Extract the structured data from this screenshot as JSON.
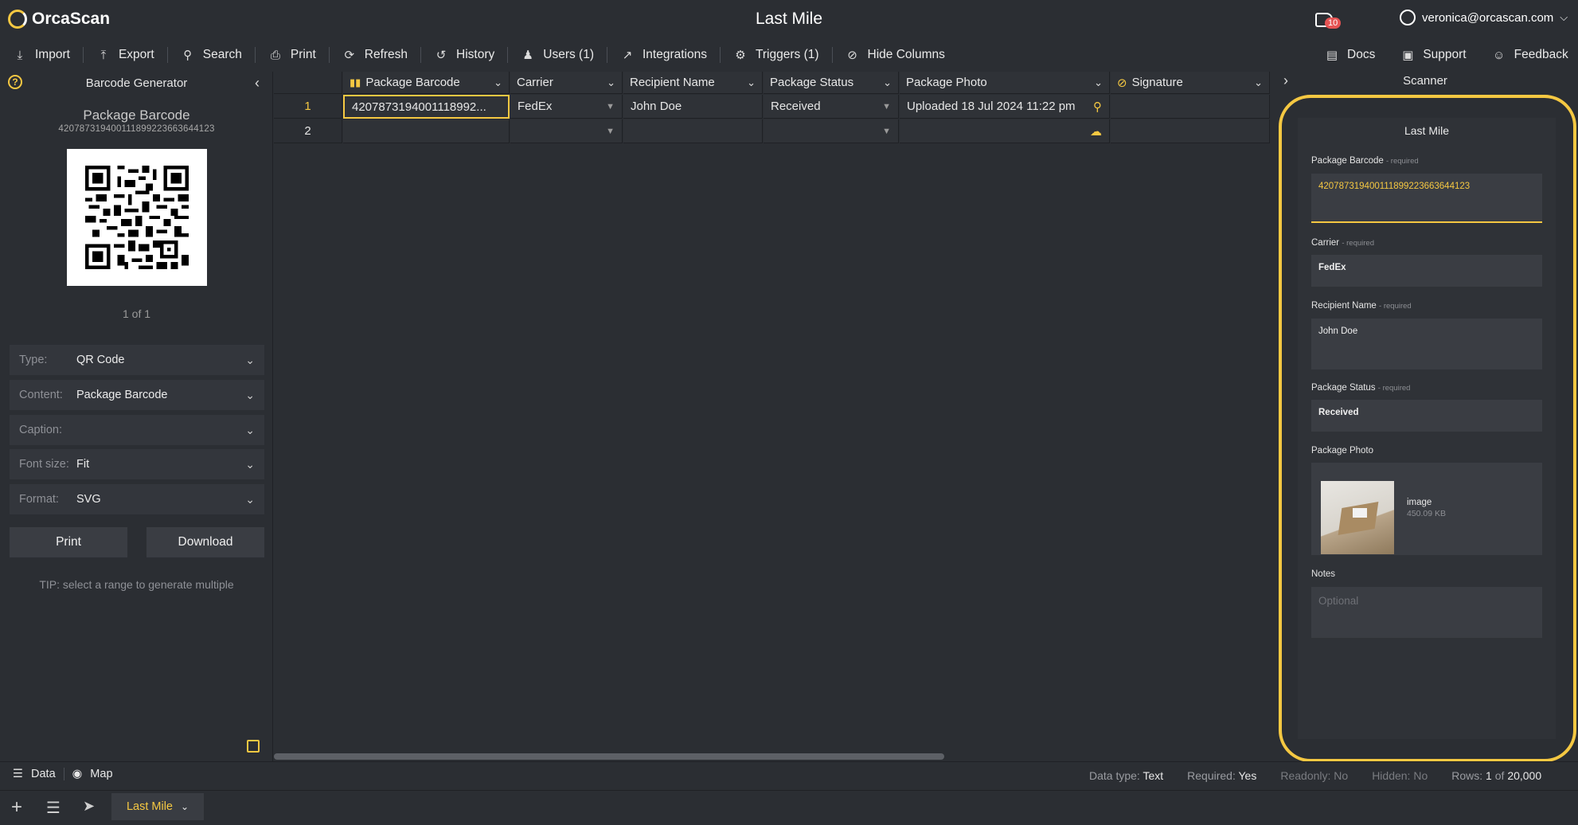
{
  "app": {
    "logo_text": "OrcaScan",
    "title": "Last Mile",
    "notification_count": "10",
    "user_email": "veronica@orcascan.com"
  },
  "toolbar": {
    "left": [
      {
        "label": "Import",
        "icon": "import-icon"
      },
      {
        "label": "Export",
        "icon": "export-icon"
      },
      {
        "label": "Search",
        "icon": "search-icon"
      },
      {
        "label": "Print",
        "icon": "print-icon"
      },
      {
        "label": "Refresh",
        "icon": "refresh-icon"
      },
      {
        "label": "History",
        "icon": "history-icon"
      },
      {
        "label": "Users (1)",
        "icon": "users-icon"
      },
      {
        "label": "Integrations",
        "icon": "integrations-icon"
      },
      {
        "label": "Triggers (1)",
        "icon": "triggers-icon"
      },
      {
        "label": "Hide Columns",
        "icon": "hide-icon"
      }
    ],
    "right": [
      {
        "label": "Docs",
        "icon": "docs-icon"
      },
      {
        "label": "Support",
        "icon": "support-icon"
      },
      {
        "label": "Feedback",
        "icon": "feedback-icon"
      }
    ]
  },
  "left_panel": {
    "title": "Barcode Generator",
    "preview_title": "Package Barcode",
    "preview_value": "420787319400111899223663644123",
    "pager": "1 of 1",
    "options": [
      {
        "label": "Type:",
        "value": "QR Code"
      },
      {
        "label": "Content:",
        "value": "Package Barcode"
      },
      {
        "label": "Caption:",
        "value": ""
      },
      {
        "label": "Font size:",
        "value": "Fit"
      },
      {
        "label": "Format:",
        "value": "SVG"
      }
    ],
    "print_label": "Print",
    "download_label": "Download",
    "tip": "TIP: select a range to generate multiple"
  },
  "grid": {
    "columns": [
      "Package Barcode",
      "Carrier",
      "Recipient Name",
      "Package Status",
      "Package Photo",
      "Signature"
    ],
    "rows": [
      {
        "num": "1",
        "cells": [
          "4207873194001118992...",
          "FedEx",
          "John Doe",
          "Received",
          "Uploaded 18 Jul 2024 11:22 pm",
          ""
        ]
      },
      {
        "num": "2",
        "cells": [
          "",
          "",
          "",
          "",
          "",
          ""
        ]
      }
    ]
  },
  "scanner": {
    "header": "Scanner",
    "form_title": "Last Mile",
    "required_tag": "- required",
    "fields": [
      {
        "label": "Package Barcode",
        "value": "420787319400111899223663644123"
      },
      {
        "label": "Carrier",
        "value": "FedEx"
      },
      {
        "label": "Recipient Name",
        "value": "John Doe"
      },
      {
        "label": "Package Status",
        "value": "Received"
      },
      {
        "label": "Package Photo",
        "file_name": "image",
        "file_size": "450.09 KB"
      },
      {
        "label": "Notes",
        "placeholder": "Optional"
      }
    ]
  },
  "footer": {
    "data_label": "Data",
    "map_label": "Map",
    "data_type_label": "Data type:",
    "data_type_value": "Text",
    "required_label": "Required:",
    "required_value": "Yes",
    "readonly_label": "Readonly:",
    "readonly_value": "No",
    "hidden_label": "Hidden:",
    "hidden_value": "No",
    "rows_label": "Rows:",
    "rows_current": "1",
    "rows_of": "of",
    "rows_max": "20,000",
    "sheet_tab": "Last Mile"
  },
  "colors": {
    "accent": "#f5c842",
    "background": "#2b2e33",
    "cell": "#2f3237",
    "badge": "#e55353"
  }
}
